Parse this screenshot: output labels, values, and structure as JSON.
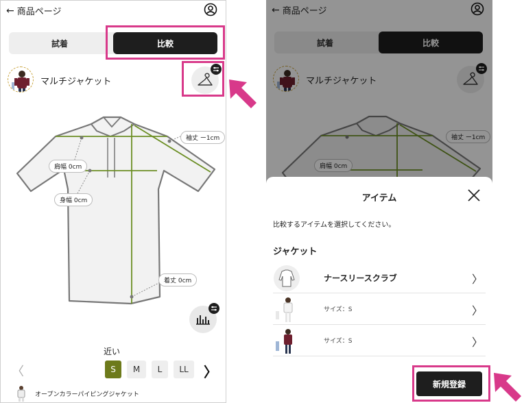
{
  "left_screen": {
    "back_label": "商品ページ",
    "tabs": {
      "try_on": "試着",
      "compare": "比較"
    },
    "product_name": "マルチジャケット",
    "measurements": {
      "sleeve": "袖丈 ー1cm",
      "shoulder": "肩幅 0cm",
      "chest": "身幅 0cm",
      "length": "着丈 0cm"
    },
    "fit_label": "近い",
    "sizes": [
      "S",
      "M",
      "L",
      "LL"
    ],
    "selected_size": "S",
    "bottom_item_name": "オープンカラーパイピングジャケット"
  },
  "right_screen": {
    "back_label": "商品ページ",
    "tabs": {
      "try_on": "試着",
      "compare": "比較"
    },
    "product_name": "マルチジャケット",
    "sleeve_label": "袖丈 ー1cm",
    "shoulder_label": "肩幅 0cm",
    "sheet": {
      "title": "アイテム",
      "description": "比較するアイテムを選択してください。",
      "category": "ジャケット",
      "items": [
        {
          "label": "ナースリースクラブ"
        },
        {
          "label": "サイズ：S"
        },
        {
          "label": "サイズ：S"
        }
      ],
      "new_button": "新規登録"
    }
  },
  "colors": {
    "accent_pink": "#d8398a",
    "active_size": "#6d7a1b",
    "measure_line": "#6b8e23",
    "dark_button": "#1e1e1e"
  },
  "icons": [
    "back-arrow-icon",
    "user-icon",
    "hanger-icon",
    "settings-badge-icon",
    "bar-chart-icon",
    "close-icon",
    "chevron-right-icon",
    "pink-arrow-icon"
  ]
}
